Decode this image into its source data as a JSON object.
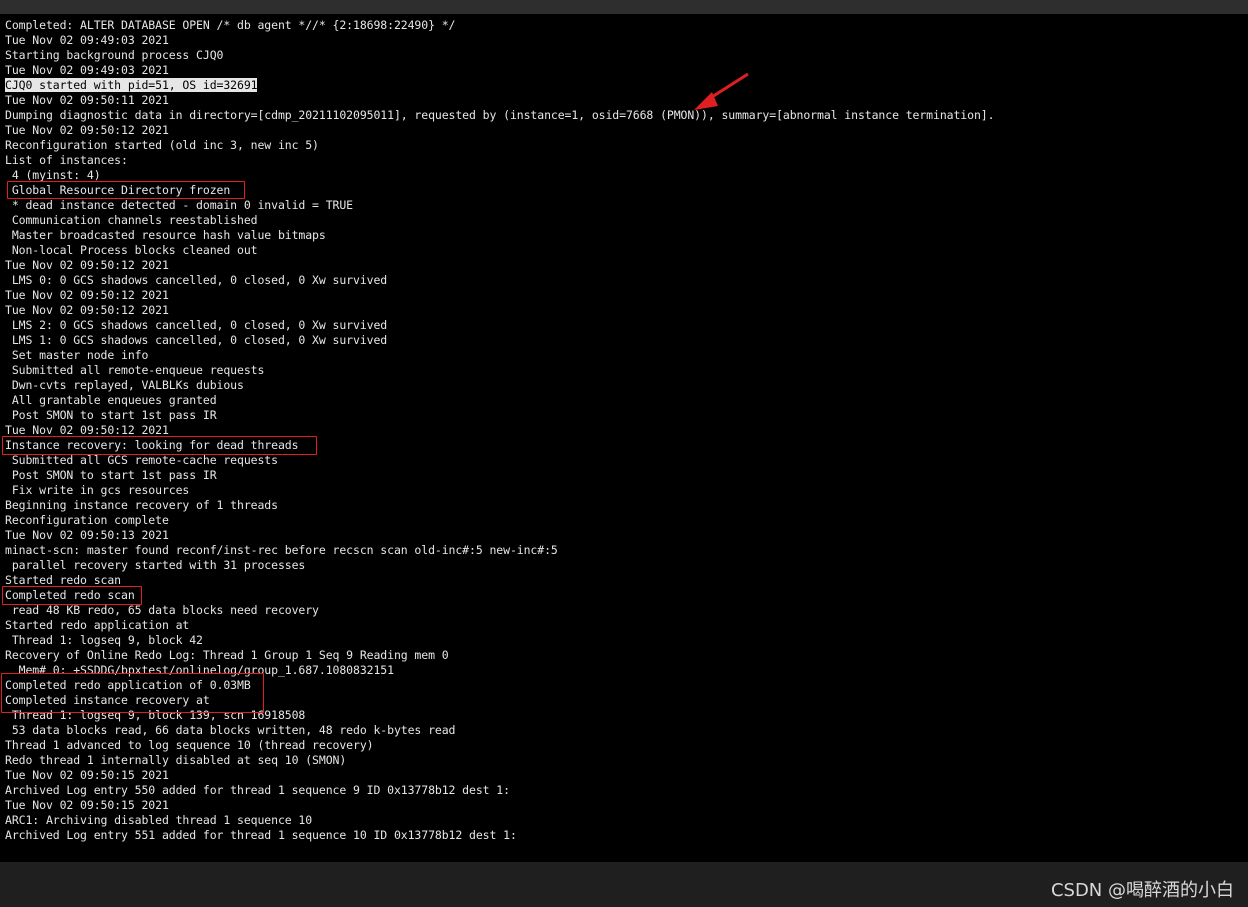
{
  "terminal": {
    "lines": [
      "Completed: ALTER DATABASE OPEN /* db agent *//* {2:18698:22490} */",
      "Tue Nov 02 09:49:03 2021",
      "Starting background process CJQ0",
      "Tue Nov 02 09:49:03 2021",
      "CJQ0 started with pid=51, OS id=32691",
      "Tue Nov 02 09:50:11 2021",
      "Dumping diagnostic data in directory=[cdmp_20211102095011], requested by (instance=1, osid=7668 (PMON)), summary=[abnormal instance termination].",
      "Tue Nov 02 09:50:12 2021",
      "Reconfiguration started (old inc 3, new inc 5)",
      "List of instances:",
      " 4 (myinst: 4)",
      " Global Resource Directory frozen",
      " * dead instance detected - domain 0 invalid = TRUE",
      " Communication channels reestablished",
      " Master broadcasted resource hash value bitmaps",
      " Non-local Process blocks cleaned out",
      "Tue Nov 02 09:50:12 2021",
      " LMS 0: 0 GCS shadows cancelled, 0 closed, 0 Xw survived",
      "Tue Nov 02 09:50:12 2021",
      "Tue Nov 02 09:50:12 2021",
      " LMS 2: 0 GCS shadows cancelled, 0 closed, 0 Xw survived",
      " LMS 1: 0 GCS shadows cancelled, 0 closed, 0 Xw survived",
      " Set master node info",
      " Submitted all remote-enqueue requests",
      " Dwn-cvts replayed, VALBLKs dubious",
      " All grantable enqueues granted",
      " Post SMON to start 1st pass IR",
      "Tue Nov 02 09:50:12 2021",
      "Instance recovery: looking for dead threads",
      " Submitted all GCS remote-cache requests",
      " Post SMON to start 1st pass IR",
      " Fix write in gcs resources",
      "Beginning instance recovery of 1 threads",
      "Reconfiguration complete",
      "Tue Nov 02 09:50:13 2021",
      "minact-scn: master found reconf/inst-rec before recscn scan old-inc#:5 new-inc#:5",
      " parallel recovery started with 31 processes",
      "Started redo scan",
      "Completed redo scan",
      " read 48 KB redo, 65 data blocks need recovery",
      "Started redo application at",
      " Thread 1: logseq 9, block 42",
      "Recovery of Online Redo Log: Thread 1 Group 1 Seq 9 Reading mem 0",
      "  Mem# 0: +SSDDG/bpxtest/onlinelog/group_1.687.1080832151",
      "Completed redo application of 0.03MB",
      "Completed instance recovery at",
      " Thread 1: logseq 9, block 139, scn 16918508",
      " 53 data blocks read, 66 data blocks written, 48 redo k-bytes read",
      "Thread 1 advanced to log sequence 10 (thread recovery)",
      "Redo thread 1 internally disabled at seq 10 (SMON)",
      "Tue Nov 02 09:50:15 2021",
      "Archived Log entry 550 added for thread 1 sequence 9 ID 0x13778b12 dest 1:",
      "Tue Nov 02 09:50:15 2021",
      "ARC1: Archiving disabled thread 1 sequence 10",
      "Archived Log entry 551 added for thread 1 sequence 10 ID 0x13778b12 dest 1:"
    ]
  },
  "annotations": {
    "box_color": "#e02020",
    "highlight_line_index": 4
  },
  "watermark": {
    "text": "CSDN @喝醉酒的小白"
  }
}
